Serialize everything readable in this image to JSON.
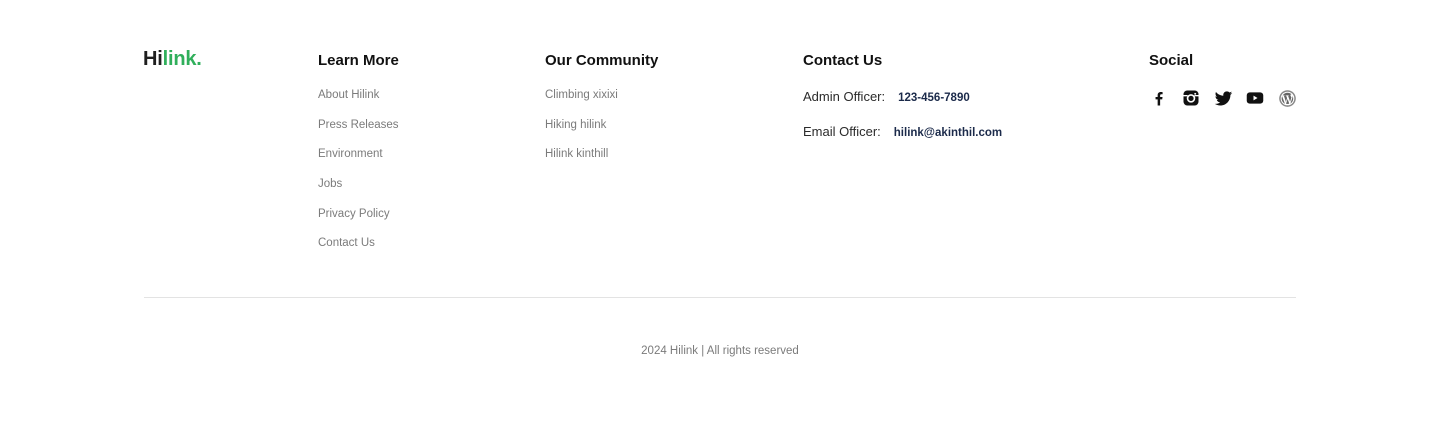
{
  "logo": {
    "part1": "Hi",
    "part2": "link."
  },
  "learn_more": {
    "title": "Learn More",
    "links": [
      "About Hilink",
      "Press Releases",
      "Environment",
      "Jobs",
      "Privacy Policy",
      "Contact Us"
    ]
  },
  "community": {
    "title": "Our Community",
    "links": [
      "Climbing xixixi",
      "Hiking hilink",
      "Hilink kinthill"
    ]
  },
  "contact": {
    "title": "Contact Us",
    "admin_label": "Admin Officer:",
    "admin_value": "123-456-7890",
    "email_label": "Email Officer:",
    "email_value": "hilink@akinthil.com"
  },
  "social": {
    "title": "Social",
    "icons": [
      "facebook-icon",
      "instagram-icon",
      "twitter-icon",
      "youtube-icon",
      "wordpress-icon"
    ]
  },
  "copyright": "2024 Hilink | All rights reserved",
  "colors": {
    "brand_green": "#30af5b",
    "text_dark": "#111111",
    "text_muted": "#7b7b7b",
    "link_navy": "#1b2a4a"
  }
}
